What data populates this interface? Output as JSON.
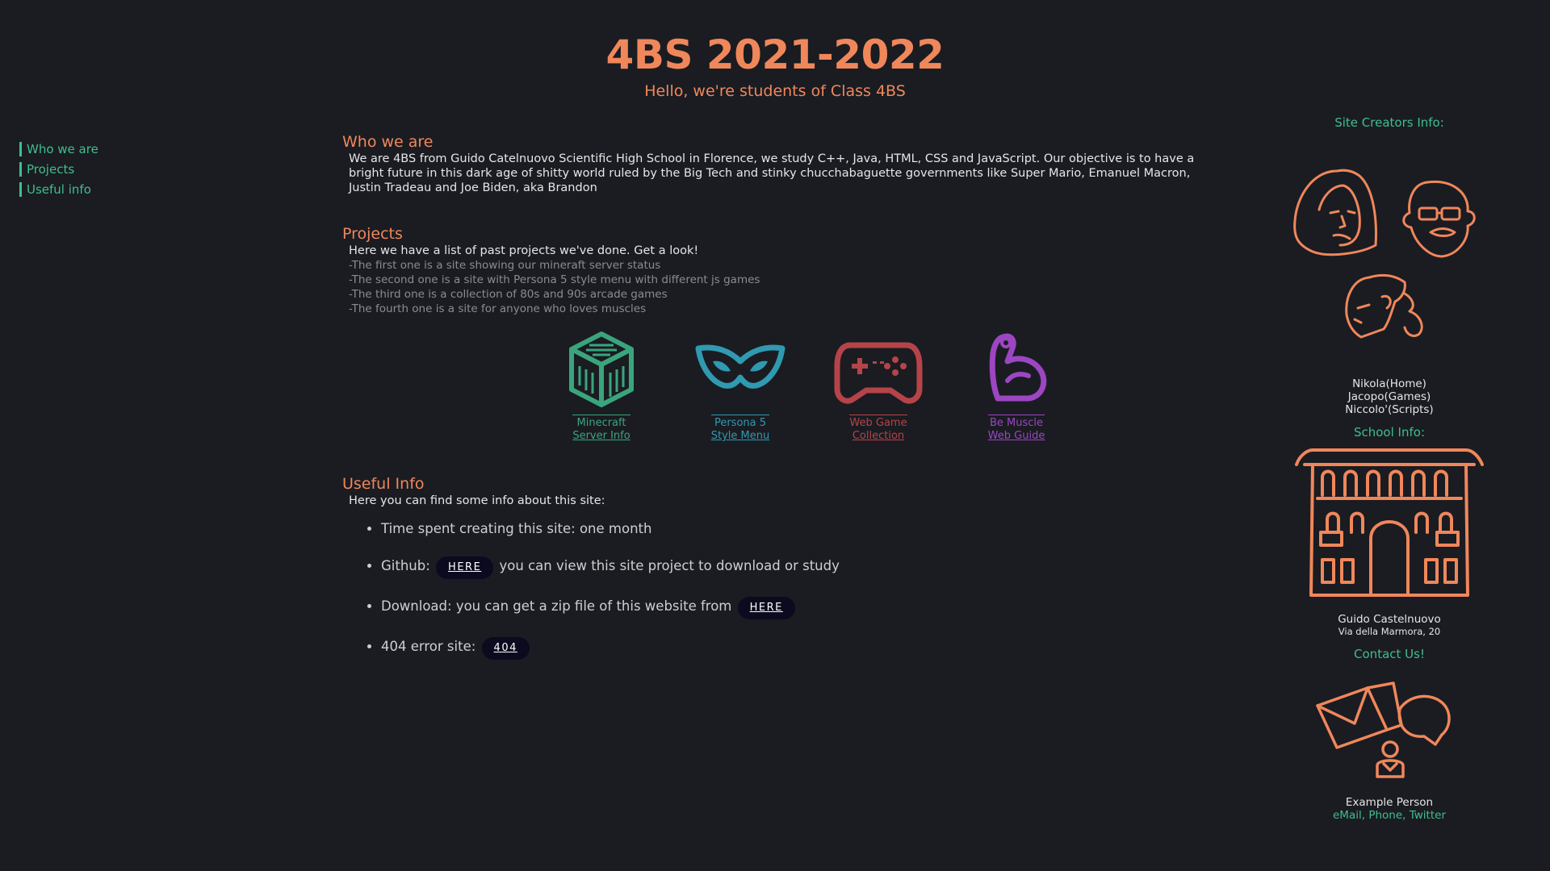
{
  "header": {
    "title": "4BS 2021-2022",
    "subtitle": "Hello, we're students of Class 4BS"
  },
  "nav": {
    "items": [
      {
        "label": "Who we are"
      },
      {
        "label": "Projects"
      },
      {
        "label": "Useful info"
      }
    ]
  },
  "who": {
    "title": "Who we are",
    "text": "We are 4BS from Guido Catelnuovo Scientific High School in Florence, we study C++, Java, HTML, CSS and JavaScript. Our objective is to have a bright future in this dark age of shitty world ruled by the Big Tech and stinky chucchabaguette governments like Super Mario, Emanuel Macron, Justin Tradeau and Joe Biden, aka Brandon"
  },
  "projects": {
    "title": "Projects",
    "intro": "Here we have a list of past projects we've done. Get a look!",
    "lines": [
      "-The first one is a site showing our mineraft server status",
      "-The second one is a site with Persona 5 style menu with different js games",
      "-The third one is a collection of 80s and 90s arcade games",
      "-The fourth one is a site for anyone who loves muscles"
    ],
    "cards": [
      {
        "line1": "Minecraft",
        "line2": "Server Info",
        "color": "#3aa57c",
        "icon": "minecraft-block-icon"
      },
      {
        "line1": "Persona 5",
        "line2": "Style Menu",
        "color": "#2f9ab0",
        "icon": "mask-icon"
      },
      {
        "line1": "Web Game",
        "line2": "Collection",
        "color": "#b54449",
        "icon": "gamepad-icon"
      },
      {
        "line1": "Be Muscle",
        "line2": "Web Guide",
        "color": "#9c46c2",
        "icon": "muscle-icon"
      }
    ]
  },
  "useful": {
    "title": "Useful Info",
    "intro": "Here you can find some info about this site:",
    "time": "Time spent creating this site: one month",
    "github_pre": "Github:",
    "github_btn": "HERE",
    "github_post": "you can view this site project to download or study",
    "download_pre": "Download: you can get a zip file of this website from",
    "download_btn": "HERE",
    "error_pre": "404 error site:",
    "error_btn": "404"
  },
  "sidebar": {
    "creators_title": "Site Creators Info:",
    "creators": [
      "Nikola(Home)",
      "Jacopo(Games)",
      "Niccolo'(Scripts)"
    ],
    "school_title": "School Info:",
    "school_name": "Guido Castelnuovo",
    "school_address": "Via della Marmora, 20",
    "contact_title": "Contact Us!",
    "contact_name": "Example Person",
    "contact_links": {
      "email": "eMail",
      "phone": "Phone",
      "twitter": "Twitter"
    },
    "accent_color": "#f0875a"
  }
}
